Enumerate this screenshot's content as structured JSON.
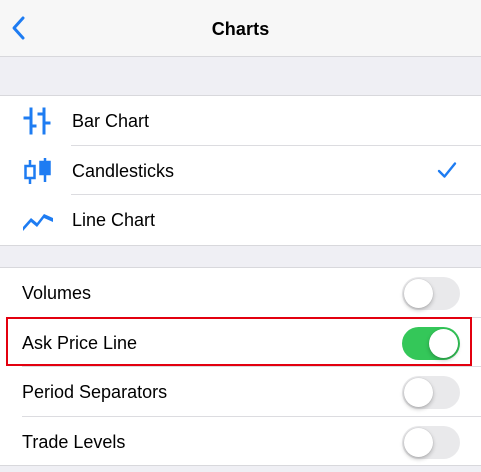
{
  "navbar": {
    "title": "Charts",
    "back_icon": "chevron-left-icon"
  },
  "chart_types": [
    {
      "label": "Bar Chart",
      "icon": "bar-chart-icon",
      "selected": false
    },
    {
      "label": "Candlesticks",
      "icon": "candlesticks-icon",
      "selected": true
    },
    {
      "label": "Line Chart",
      "icon": "line-chart-icon",
      "selected": false
    }
  ],
  "options": [
    {
      "label": "Volumes",
      "on": false
    },
    {
      "label": "Ask Price Line",
      "on": true
    },
    {
      "label": "Period Separators",
      "on": false
    },
    {
      "label": "Trade Levels",
      "on": false
    }
  ],
  "colors": {
    "accent": "#1e7cf2",
    "toggle_on": "#34c759",
    "highlight": "#e3000f"
  }
}
